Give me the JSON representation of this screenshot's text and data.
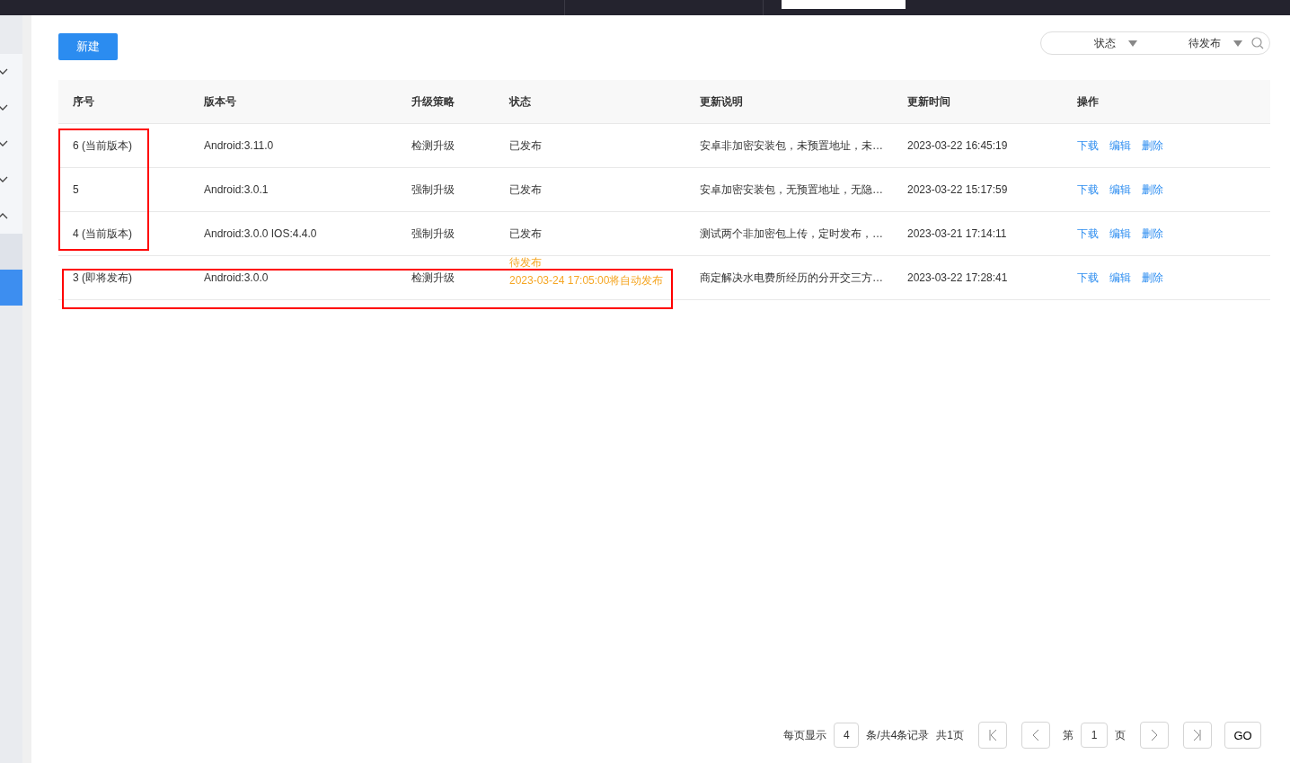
{
  "sidebar": {
    "items": [
      {
        "kind": "group",
        "expanded": false
      },
      {
        "kind": "group",
        "expanded": false
      },
      {
        "kind": "group",
        "expanded": false
      },
      {
        "kind": "group",
        "expanded": false
      },
      {
        "kind": "group",
        "expanded": true
      },
      {
        "kind": "link",
        "selected": false
      },
      {
        "kind": "link",
        "selected": true
      }
    ]
  },
  "new_button": "新建",
  "filter": {
    "fields": [
      {
        "value": "状态"
      },
      {
        "value": "待发布"
      }
    ]
  },
  "table": {
    "columns": [
      "序号",
      "版本号",
      "升级策略",
      "状态",
      "更新说明",
      "更新时间",
      "操作"
    ],
    "rows": [
      {
        "index": "6 (当前版本)",
        "version": "Android:3.11.0",
        "strategy": "检测升级",
        "status": [
          {
            "kind": "published",
            "text": "已发布"
          }
        ],
        "notes": "安卓非加密安装包，未预置地址，未…",
        "time": "2023-03-22 16:45:19",
        "actions": [
          "下载",
          "编辑",
          "删除"
        ]
      },
      {
        "index": "5",
        "version": "Android:3.0.1",
        "strategy": "强制升级",
        "status": [
          {
            "kind": "published",
            "text": "已发布"
          }
        ],
        "notes": "安卓加密安装包，无预置地址，无隐…",
        "time": "2023-03-22 15:17:59",
        "actions": [
          "下载",
          "编辑",
          "删除"
        ]
      },
      {
        "index": "4 (当前版本)",
        "version": "Android:3.0.0 IOS:4.4.0",
        "strategy": "强制升级",
        "status": [
          {
            "kind": "published",
            "text": "已发布"
          }
        ],
        "notes": "测试两个非加密包上传，定时发布，…",
        "time": "2023-03-21 17:14:11",
        "actions": [
          "下载",
          "编辑",
          "删除"
        ]
      },
      {
        "index": "3 (即将发布)",
        "version": "Android:3.0.0",
        "strategy": "检测升级",
        "status": [
          {
            "kind": "pending",
            "text": "待发布"
          },
          {
            "kind": "pending",
            "text": "2023-03-24 17:05:00将自动发布"
          }
        ],
        "notes": "商定解决水电费所经历的分开交三方…",
        "time": "2023-03-22 17:28:41",
        "actions": [
          "下载",
          "编辑",
          "删除"
        ]
      }
    ]
  },
  "pagination": {
    "per_page_label": "每页显示",
    "per_page": "4",
    "summary": "条/共4条记录",
    "pages": "共1页",
    "page_prefix": "第",
    "page": "1",
    "page_suffix": "页",
    "go": "GO"
  }
}
